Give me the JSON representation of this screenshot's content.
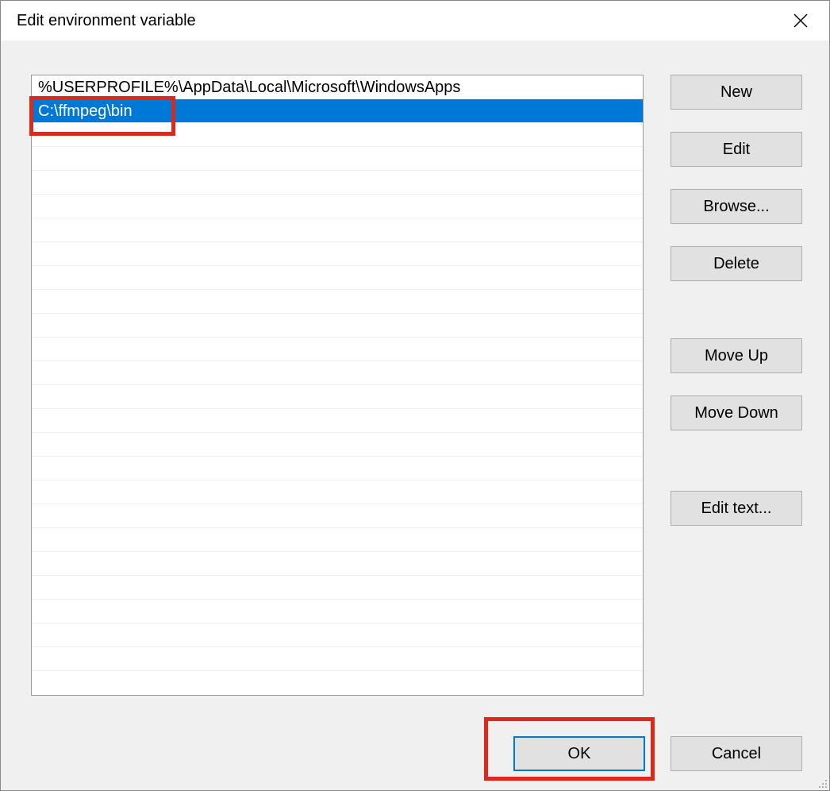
{
  "window": {
    "title": "Edit environment variable"
  },
  "list": {
    "items": [
      {
        "value": "%USERPROFILE%\\AppData\\Local\\Microsoft\\WindowsApps",
        "selected": false
      },
      {
        "value": "C:\\ffmpeg\\bin",
        "selected": true
      }
    ],
    "empty_rows": 23
  },
  "buttons": {
    "new": "New",
    "edit": "Edit",
    "browse": "Browse...",
    "delete": "Delete",
    "move_up": "Move Up",
    "move_down": "Move Down",
    "edit_text": "Edit text...",
    "ok": "OK",
    "cancel": "Cancel"
  }
}
